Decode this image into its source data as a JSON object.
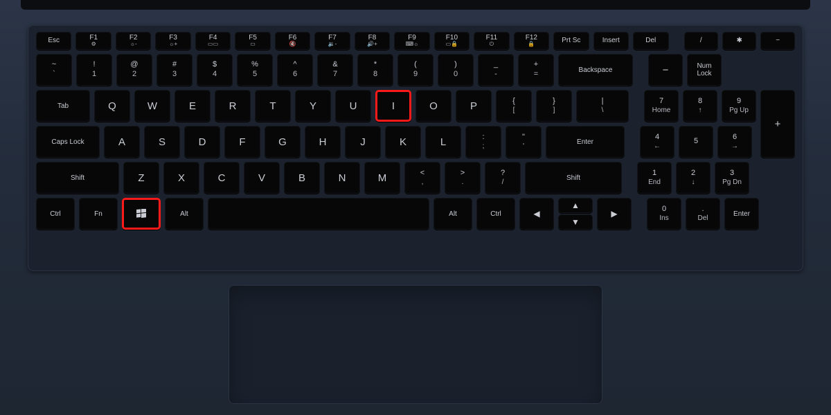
{
  "highlight": {
    "keys": [
      "I",
      "Win"
    ]
  },
  "funcRow": [
    {
      "top": "Esc",
      "sub": ""
    },
    {
      "top": "F1",
      "sub": "⚙"
    },
    {
      "top": "F2",
      "sub": "☼-"
    },
    {
      "top": "F3",
      "sub": "☼+"
    },
    {
      "top": "F4",
      "sub": "▭▭"
    },
    {
      "top": "F5",
      "sub": "▭"
    },
    {
      "top": "F6",
      "sub": "🔇"
    },
    {
      "top": "F7",
      "sub": "🔉-"
    },
    {
      "top": "F8",
      "sub": "🔊+"
    },
    {
      "top": "F9",
      "sub": "⌨☼"
    },
    {
      "top": "F10",
      "sub": "▭🔒"
    },
    {
      "top": "F11",
      "sub": "⏻"
    },
    {
      "top": "F12",
      "sub": "🔒"
    },
    {
      "top": "Prt Sc",
      "sub": ""
    },
    {
      "top": "Insert",
      "sub": ""
    },
    {
      "top": "Del",
      "sub": ""
    },
    {
      "top": "/",
      "sub": ""
    },
    {
      "top": "✱",
      "sub": ""
    },
    {
      "top": "−",
      "sub": ""
    }
  ],
  "numRow": [
    {
      "u": "~",
      "l": "`"
    },
    {
      "u": "!",
      "l": "1"
    },
    {
      "u": "@",
      "l": "2"
    },
    {
      "u": "#",
      "l": "3"
    },
    {
      "u": "$",
      "l": "4"
    },
    {
      "u": "%",
      "l": "5"
    },
    {
      "u": "^",
      "l": "6"
    },
    {
      "u": "&",
      "l": "7"
    },
    {
      "u": "*",
      "l": "8"
    },
    {
      "u": "(",
      "l": "9"
    },
    {
      "u": ")",
      "l": "0"
    },
    {
      "u": "_",
      "l": "-"
    },
    {
      "u": "+",
      "l": "="
    }
  ],
  "numRow_backspace": "Backspace",
  "numRow_numpad": [
    "−",
    "Num\nLock"
  ],
  "qRow": {
    "tab": "Tab",
    "letters": [
      "Q",
      "W",
      "E",
      "R",
      "T",
      "Y",
      "U",
      "I",
      "O",
      "P"
    ],
    "brackets": [
      {
        "u": "{",
        "l": "["
      },
      {
        "u": "}",
        "l": "]"
      },
      {
        "u": "|",
        "l": "\\"
      }
    ],
    "numpad": [
      {
        "u": "7",
        "l": "Home"
      },
      {
        "u": "8",
        "l": "↑"
      },
      {
        "u": "9",
        "l": "Pg Up"
      }
    ]
  },
  "aRow": {
    "caps": "Caps Lock",
    "letters": [
      "A",
      "S",
      "D",
      "F",
      "G",
      "H",
      "J",
      "K",
      "L"
    ],
    "punct": [
      {
        "u": ":",
        "l": ";"
      },
      {
        "u": "\"",
        "l": "'"
      }
    ],
    "enter": "Enter",
    "numpad": [
      {
        "u": "4",
        "l": "←"
      },
      {
        "u": "5",
        "l": ""
      },
      {
        "u": "6",
        "l": "→"
      }
    ]
  },
  "zRow": {
    "shiftL": "Shift",
    "letters": [
      "Z",
      "X",
      "C",
      "V",
      "B",
      "N",
      "M"
    ],
    "punct": [
      {
        "u": "<",
        "l": ","
      },
      {
        "u": ">",
        "l": "."
      },
      {
        "u": "?",
        "l": "/"
      }
    ],
    "shiftR": "Shift",
    "numpad": [
      {
        "u": "1",
        "l": "End"
      },
      {
        "u": "2",
        "l": "↓"
      },
      {
        "u": "3",
        "l": "Pg Dn"
      }
    ]
  },
  "bottom": {
    "ctrlL": "Ctrl",
    "fn": "Fn",
    "win": "",
    "altL": "Alt",
    "space": "",
    "altR": "Alt",
    "ctrlR": "Ctrl",
    "arrows": {
      "up": "▲",
      "left": "◀",
      "down": "▼",
      "right": "▶"
    },
    "numpad": [
      {
        "u": "0",
        "l": "Ins"
      },
      {
        "u": ".",
        "l": "Del"
      }
    ],
    "enter": "Enter"
  },
  "numpad_plus": "+"
}
